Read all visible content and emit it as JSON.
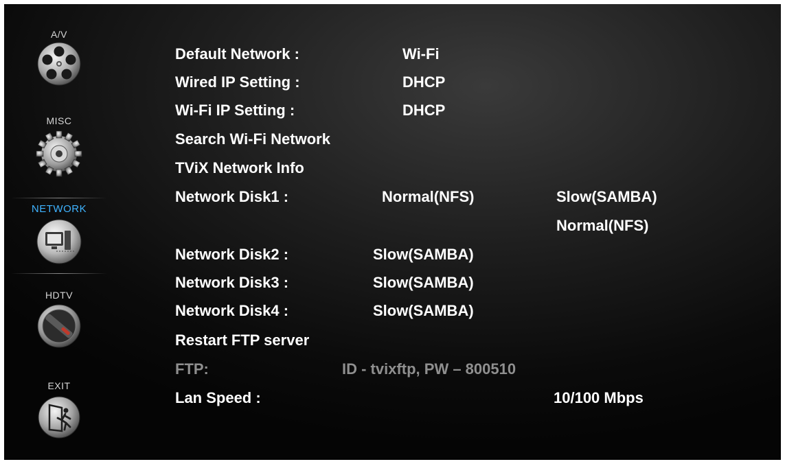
{
  "sidebar": {
    "items": [
      {
        "label": "A/V",
        "icon": "film-reel-icon",
        "active": false
      },
      {
        "label": "MISC",
        "icon": "gear-disc-icon",
        "active": false
      },
      {
        "label": "NETWORK",
        "icon": "computer-network-icon",
        "active": true
      },
      {
        "label": "HDTV",
        "icon": "hdtv-knob-icon",
        "active": false
      },
      {
        "label": "EXIT",
        "icon": "exit-door-icon",
        "active": false
      }
    ],
    "active_color": "#3fb3ff"
  },
  "settings": {
    "default_network": {
      "label": "Default Network :",
      "value": "Wi-Fi"
    },
    "wired_ip": {
      "label": "Wired IP Setting :",
      "value": "DHCP"
    },
    "wifi_ip": {
      "label": "Wi-Fi IP Setting :",
      "value": "DHCP"
    },
    "search_wifi": {
      "label": "Search Wi-Fi Network"
    },
    "tvix_info": {
      "label": "TViX Network Info"
    },
    "disk1": {
      "label": "Network Disk1 :",
      "value": "Normal(NFS)",
      "options": [
        "Slow(SAMBA)",
        "Normal(NFS)"
      ]
    },
    "disk2": {
      "label": "Network Disk2 :",
      "value": "Slow(SAMBA)"
    },
    "disk3": {
      "label": "Network Disk3 :",
      "value": "Slow(SAMBA)"
    },
    "disk4": {
      "label": "Network Disk4 :",
      "value": "Slow(SAMBA)"
    },
    "restart_ftp": {
      "label": "Restart FTP server"
    },
    "ftp": {
      "label": "FTP:",
      "value": "ID - tvixftp, PW – 800510"
    },
    "lan_speed": {
      "label": "Lan Speed :",
      "value": "10/100 Mbps"
    }
  }
}
